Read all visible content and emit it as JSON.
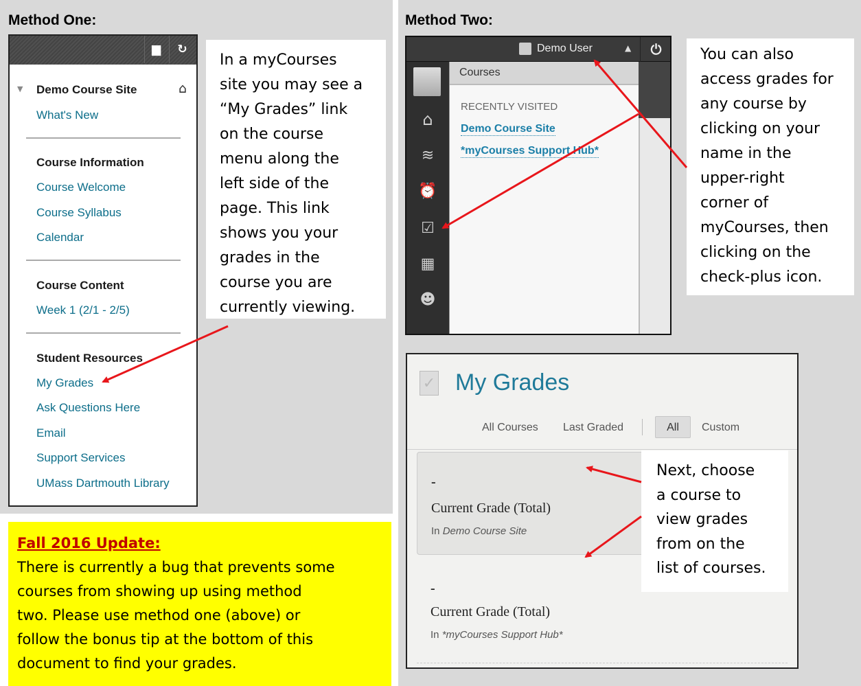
{
  "method_one": {
    "heading": "Method One:",
    "course_title": "Demo Course Site",
    "whats_new": "What's New",
    "sections": [
      {
        "title": "Course Information",
        "items": [
          "Course Welcome",
          "Course Syllabus",
          "Calendar"
        ]
      },
      {
        "title": "Course Content",
        "items": [
          "Week 1 (2/1 - 2/5)"
        ]
      },
      {
        "title": "Student Resources",
        "items": [
          "My Grades",
          "Ask Questions Here",
          "Email",
          "Support Services",
          "UMass Dartmouth Library"
        ]
      }
    ],
    "callout_lines": [
      "In a myCourses",
      "site you may see a",
      "“My Grades” link",
      "on the course",
      "menu along the",
      "left side of the",
      "page. This link",
      "shows you your",
      "grades in the",
      "course you are",
      "currently viewing."
    ]
  },
  "method_two": {
    "heading": "Method Two:",
    "user_name": "Demo User",
    "dropdown_title": "Courses",
    "recent_label": "RECENTLY VISITED",
    "recent_courses": [
      "Demo Course Site",
      "*myCourses Support Hub*"
    ],
    "callout_lines": [
      "You can also",
      "access grades for",
      "any course by",
      "clicking on your",
      "name in the",
      "upper-right",
      "corner of",
      "myCourses, then",
      "clicking on the",
      "check-plus icon."
    ]
  },
  "my_grades": {
    "title": "My Grades",
    "filters": [
      "All Courses",
      "Last Graded",
      "All",
      "Custom"
    ],
    "entries": [
      {
        "grade": "-",
        "label": "Current Grade (Total)",
        "in_prefix": "In",
        "course": "Demo Course Site"
      },
      {
        "grade": "-",
        "label": "Current Grade (Total)",
        "in_prefix": "In",
        "course": "*myCourses Support Hub*"
      }
    ],
    "callout_lines": [
      "Next, choose",
      "a course to",
      "view grades",
      "from on the",
      "list of courses."
    ]
  },
  "update": {
    "title": "Fall 2016 Update:",
    "body_lines": [
      "There is currently a bug that prevents some",
      "courses from showing up using method",
      "two. Please use method one (above) or",
      "follow the bonus tip at the bottom of this",
      "document to find your grades."
    ]
  },
  "colors": {
    "arrow": "#e8161b",
    "link": "#0d6e8a",
    "highlight": "#ffff00",
    "panel": "#d9d9d9"
  },
  "icons": [
    "folder-icon",
    "refresh-icon",
    "home-icon",
    "user-icon",
    "power-icon",
    "blackboard-icon",
    "updates-icon",
    "alarm-icon",
    "check-plus-icon",
    "calendar-icon",
    "smiley-icon"
  ]
}
